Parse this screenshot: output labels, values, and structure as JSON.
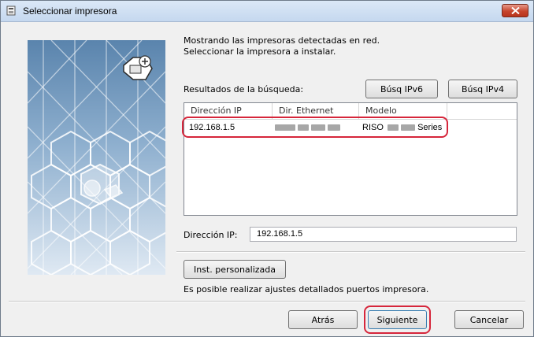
{
  "window": {
    "title": "Seleccionar impresora",
    "close_icon": "close-x-icon"
  },
  "intro": {
    "line1": "Mostrando las impresoras detectadas en red.",
    "line2": "Seleccionar la impresora a instalar."
  },
  "search": {
    "label": "Resultados de la búsqueda:",
    "ipv6_button": "Búsq IPv6",
    "ipv4_button": "Búsq IPv4"
  },
  "table": {
    "columns": [
      "Dirección IP",
      "Dir. Ethernet",
      "Modelo"
    ],
    "rows": [
      {
        "ip": "192.168.1.5",
        "ethernet": "",
        "model_prefix": "RISO",
        "model_suffix": "Series"
      }
    ]
  },
  "ip_address": {
    "label": "Dirección IP:",
    "value": "192.168.1.5"
  },
  "custom_install": {
    "button": "Inst. personalizada",
    "note": "Es posible realizar ajustes detallados puertos impresora."
  },
  "footer": {
    "back_button": "Atrás",
    "next_button": "Siguiente",
    "cancel_button": "Cancelar"
  },
  "colors": {
    "highlight": "#d6263b",
    "side_panel": "#c9d9ec",
    "close_button": "#c6442c"
  }
}
